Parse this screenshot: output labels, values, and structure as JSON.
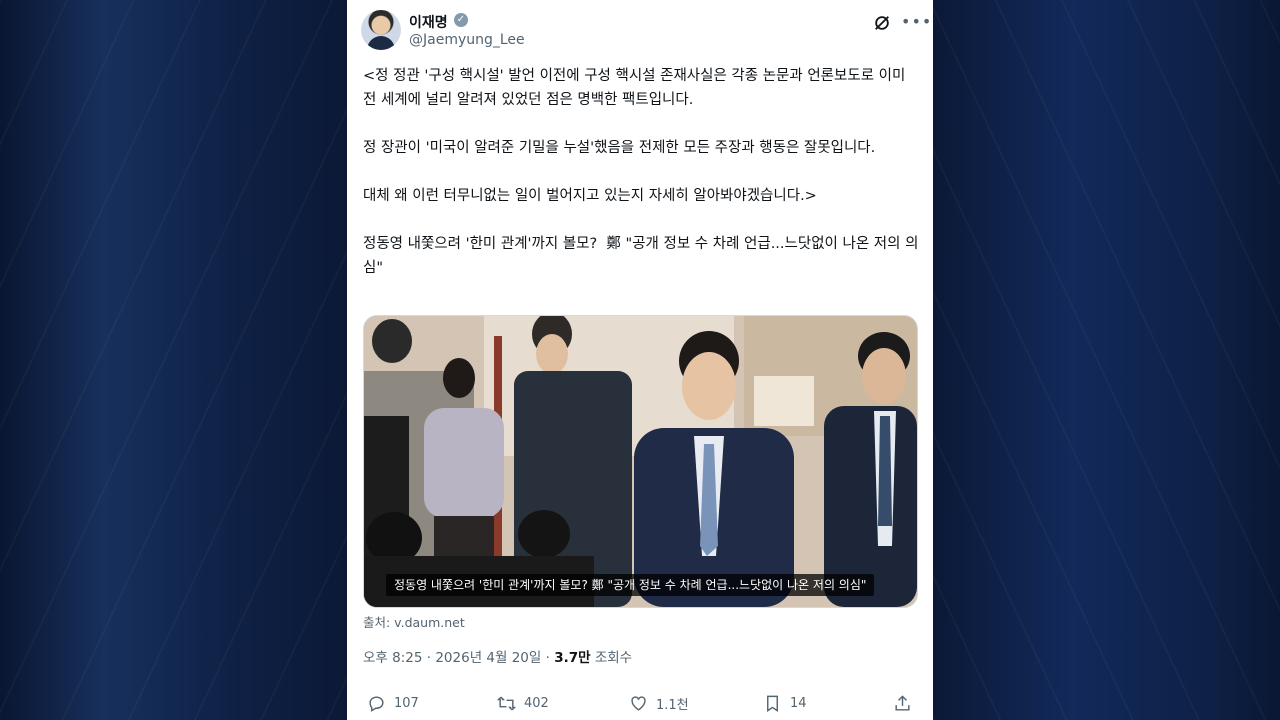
{
  "tweet": {
    "author_name": "이재명",
    "handle": "@Jaemyung_Lee",
    "paragraphs": [
      "<정 정관 '구성 핵시설' 발언 이전에 구성 핵시설 존재사실은 각종 논문과 언론보도로 이미 전 세계에 널리 알려져 있었던 점은 명백한 팩트입니다.",
      "정 장관이 '미국이 알려준 기밀을 누설'했음을 전제한 모든 주장과 행동은 잘못입니다.",
      "대체 왜 이런 터무니없는 일이 벌어지고 있는지 자세히 알아봐야겠습니다.>",
      "정동영 내쫓으려 '한미 관계'까지 볼모?  鄭 \"공개 정보 수 차례 언급...느닷없이 나온 저의 의심\""
    ],
    "media_caption": "정동영 내쫓으려 '한미 관계'까지 볼모? 鄭 \"공개 정보 수 차례 언급...느닷없이 나온 저의 의심\"",
    "source": "출처: v.daum.net",
    "time": "오후 8:25",
    "date": "2026년 4월 20일",
    "views_count": "3.7만",
    "views_label": "조회수",
    "replies": "107",
    "reposts": "402",
    "likes": "1.1천",
    "bookmarks": "14"
  },
  "icons": [
    "verified-badge-icon",
    "grok-icon",
    "more-icon",
    "reply-icon",
    "repost-icon",
    "like-icon",
    "bookmark-icon",
    "share-icon"
  ],
  "colors": {
    "text": "#0f1419",
    "muted": "#536471",
    "verified": "#829aab"
  }
}
